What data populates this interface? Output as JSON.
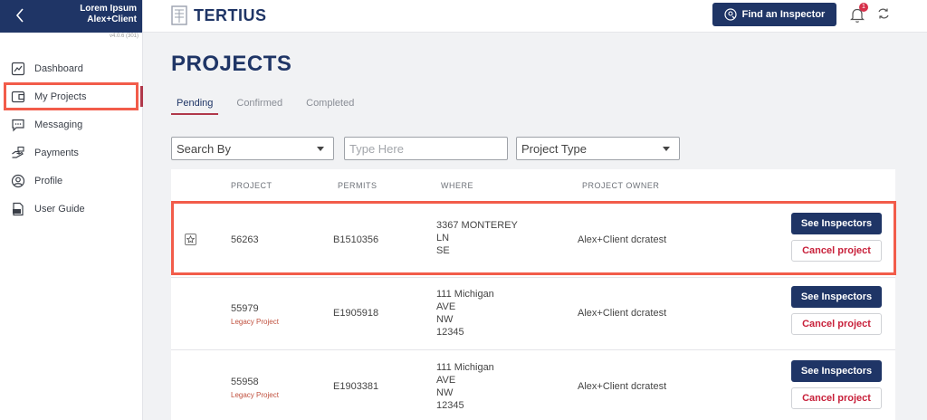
{
  "sidebar": {
    "user_name": "Lorem Ipsum",
    "user_role": "Alex+Client",
    "version": "v4.0.6 (301)",
    "items": [
      {
        "label": "Dashboard",
        "icon": "dashboard-icon"
      },
      {
        "label": "My Projects",
        "icon": "projects-icon"
      },
      {
        "label": "Messaging",
        "icon": "chat-icon"
      },
      {
        "label": "Payments",
        "icon": "payments-icon"
      },
      {
        "label": "Profile",
        "icon": "profile-icon"
      },
      {
        "label": "User Guide",
        "icon": "pdf-icon"
      }
    ],
    "active": "My Projects"
  },
  "header": {
    "logo_text": "TERTIUS",
    "find_inspector_label": "Find an Inspector",
    "notification_count": "1"
  },
  "page": {
    "title": "PROJECTS",
    "tabs": [
      "Pending",
      "Confirmed",
      "Completed"
    ],
    "active_tab": "Pending"
  },
  "filters": {
    "search_by": "Search By",
    "search_placeholder": "Type Here",
    "project_type": "Project Type"
  },
  "table": {
    "columns": [
      "PROJECT",
      "PERMITS",
      "WHERE",
      "PROJECT OWNER"
    ],
    "see_label": "See Inspectors",
    "cancel_label": "Cancel project",
    "rows": [
      {
        "project": "56263",
        "legacy": "",
        "permit": "B1510356",
        "where": [
          "3367 MONTEREY",
          "LN",
          "SE"
        ],
        "owner": "Alex+Client dcratest"
      },
      {
        "project": "55979",
        "legacy": "Legacy Project",
        "permit": "E1905918",
        "where": [
          "111 Michigan",
          "AVE",
          "NW",
          "12345"
        ],
        "owner": "Alex+Client dcratest"
      },
      {
        "project": "55958",
        "legacy": "Legacy Project",
        "permit": "E1903381",
        "where": [
          "111 Michigan",
          "AVE",
          "NW",
          "12345"
        ],
        "owner": "Alex+Client dcratest"
      }
    ]
  },
  "colors": {
    "brand": "#1f3566",
    "accent": "#b0384a",
    "highlight": "#f25c4a"
  }
}
